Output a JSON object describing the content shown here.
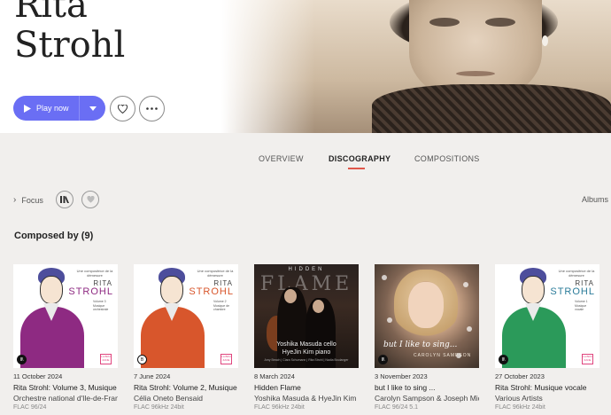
{
  "artist": {
    "line1": "Rita",
    "line2": "Strohl"
  },
  "actions": {
    "play_label": "Play now"
  },
  "tabs": [
    {
      "label": "OVERVIEW"
    },
    {
      "label": "DISCOGRAPHY"
    },
    {
      "label": "COMPOSITIONS"
    }
  ],
  "filters": {
    "focus_label": "Focus",
    "albums_label": "Albums"
  },
  "section": {
    "title": "Composed by (9)"
  },
  "covers": {
    "rs_small": "Une compositrice de la démesure",
    "rs_first": "RITA",
    "rs_last": "STROHL",
    "rs1_vol": "Volume 3 Musique orchestrale",
    "rs2_vol": "Volume 2 Musique de chambre",
    "rs5_vol": "Volume 1 Musique vocale",
    "hf_top": "HIDDEN",
    "hf_big": "FLAME",
    "hf_name1": "Yoshika Masuda cello",
    "hf_name2": "HyeJin Kim piano",
    "hf_foot": "Amy Beach | Clara Schumann | Rita Strohl | Nadia Boulanger",
    "cs_title": "but I like to sing...",
    "cs_artist": "CAROLYN SAMPSON",
    "label_logo": "B",
    "pink_box": "LA BRU ZANE"
  },
  "albums": [
    {
      "date": "11 October 2024",
      "title": "Rita Strohl: Volume 3, Musique orchestrale",
      "artist": "Orchestre national d'Ile-de-France",
      "format": "FLAC 96/24"
    },
    {
      "date": "7 June 2024",
      "title": "Rita Strohl: Volume 2, Musique de chambre",
      "artist": "Célia Oneto Bensaid",
      "format": "FLAC 96kHz 24bit"
    },
    {
      "date": "8 March 2024",
      "title": "Hidden Flame",
      "artist": "Yoshika Masuda & HyeJin Kim",
      "format": "FLAC 96kHz 24bit"
    },
    {
      "date": "3 November 2023",
      "title": "but I like to sing ...",
      "artist": "Carolyn Sampson & Joseph Middleton",
      "format": "FLAC 96/24 5.1"
    },
    {
      "date": "27 October 2023",
      "title": "Rita Strohl: Musique vocale",
      "artist": "Various Artists",
      "format": "FLAC 96kHz 24bit"
    }
  ],
  "colors": {
    "accent": "#6a6ef4",
    "tab_underline": "#e0574a",
    "dress1": "#8e2a82",
    "dress2": "#d8562c",
    "dress5": "#2b9a5a"
  },
  "icons": [
    "play-icon",
    "chevron-down-icon",
    "heart-icon",
    "more-icon",
    "chevron-right-icon",
    "label-filter-icon",
    "heart-filter-icon"
  ]
}
